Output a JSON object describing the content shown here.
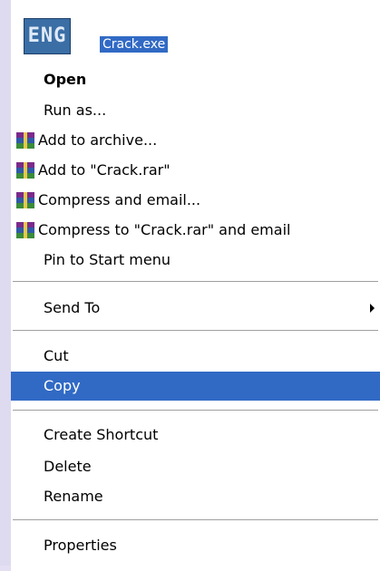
{
  "file": {
    "icon_text": "ENG",
    "name": "Crack.exe"
  },
  "menu": {
    "open": "Open",
    "run_as": "Run as...",
    "add_to_archive": "Add to archive...",
    "add_to_rar": "Add to \"Crack.rar\"",
    "compress_and_email": "Compress and email...",
    "compress_to_rar_and_email": "Compress to \"Crack.rar\" and email",
    "pin_to_start": "Pin to Start menu",
    "send_to": "Send To",
    "cut": "Cut",
    "copy": "Copy",
    "create_shortcut": "Create Shortcut",
    "delete": "Delete",
    "rename": "Rename",
    "properties": "Properties"
  },
  "colors": {
    "highlight": "#316ac5",
    "highlight_text": "#ffffff",
    "menu_bg": "#ffffff",
    "desktop_edge": "#e4dff2"
  },
  "icons": {
    "file": "exe-file-icon",
    "archive": "winrar-archive-icon",
    "submenu": "submenu-arrow-icon"
  },
  "state": {
    "highlighted_item": "copy"
  }
}
